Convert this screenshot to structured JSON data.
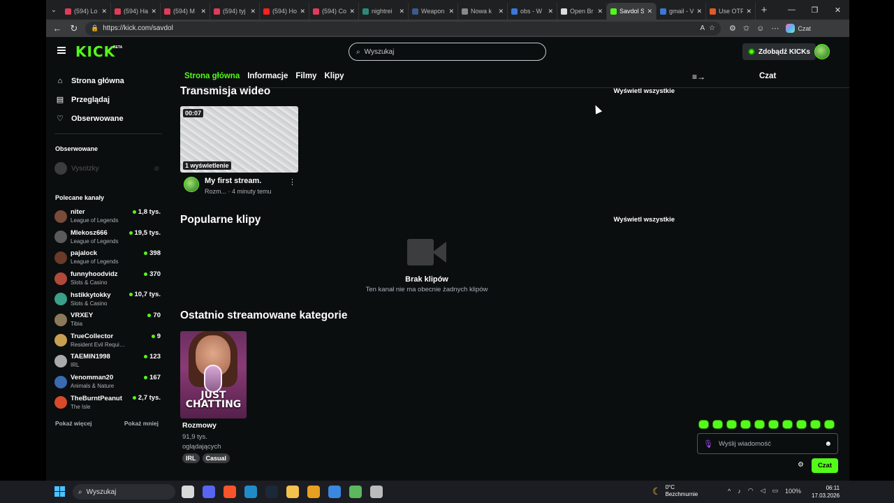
{
  "browser": {
    "tabs": [
      {
        "title": "(594) Lo",
        "color": "#e03c5a"
      },
      {
        "title": "(594) Ha",
        "color": "#e03c5a"
      },
      {
        "title": "(594) M",
        "color": "#e03c5a"
      },
      {
        "title": "(594) tyj",
        "color": "#e03c5a"
      },
      {
        "title": "(594) Ho",
        "color": "#ff2020"
      },
      {
        "title": "(594) Co",
        "color": "#e03c5a"
      },
      {
        "title": "nightrei",
        "color": "#2a8a7a"
      },
      {
        "title": "Weapon",
        "color": "#3a5a8a"
      },
      {
        "title": "Nowa k",
        "color": "#888888"
      },
      {
        "title": "obs - W",
        "color": "#3a78d8"
      },
      {
        "title": "Open Br",
        "color": "#dddddd"
      },
      {
        "title": "Savdol S",
        "color": "#53fc18",
        "active": true
      },
      {
        "title": "gmail - V",
        "color": "#3a78d8"
      },
      {
        "title": "Use OTP",
        "color": "#e05a2a"
      }
    ],
    "new_tab": "+",
    "url": "https://kick.com/savdol",
    "copilot_label": "Czat"
  },
  "header": {
    "logo": "KICK",
    "beta": "BETA",
    "search_placeholder": "Wyszukaj",
    "kicks_button": "Zdobądź KICKs"
  },
  "sidebar": {
    "nav": [
      {
        "label": "Strona główna",
        "icon": "home-icon",
        "glyph": "⌂"
      },
      {
        "label": "Przeglądaj",
        "icon": "browse-icon",
        "glyph": "▤"
      },
      {
        "label": "Obserwowane",
        "icon": "heart-icon",
        "glyph": "♡"
      }
    ],
    "followed_title": "Obserwowane",
    "followed": [
      {
        "name": "Vysotzky"
      }
    ],
    "recommended_title": "Polecane kanały",
    "recommended": [
      {
        "name": "niter",
        "category": "League of Legends",
        "viewers": "1,8 tys.",
        "color": "#7a4a3a"
      },
      {
        "name": "Mlekosz666",
        "category": "League of Legends",
        "viewers": "19,5 tys.",
        "color": "#5a5a5a"
      },
      {
        "name": "pajalock",
        "category": "League of Legends",
        "viewers": "398",
        "color": "#6a3a2a"
      },
      {
        "name": "funnyhoodvidz",
        "category": "Slots & Casino",
        "viewers": "370",
        "color": "#b04a3a"
      },
      {
        "name": "hstikkytokky",
        "category": "Slots & Casino",
        "viewers": "10,7 tys.",
        "color": "#3aa08a"
      },
      {
        "name": "VRXEY",
        "category": "Tibia",
        "viewers": "70",
        "color": "#8a7a5a"
      },
      {
        "name": "TrueCollector",
        "category": "Resident Evil Requiem",
        "viewers": "9",
        "color": "#c8a050"
      },
      {
        "name": "TAEMIN1998",
        "category": "IRL",
        "viewers": "123",
        "color": "#aaaaaa"
      },
      {
        "name": "Venomman20",
        "category": "Animals & Nature",
        "viewers": "167",
        "color": "#3a6ab0"
      },
      {
        "name": "TheBurntPeanut",
        "category": "The Isle",
        "viewers": "2,7 tys.",
        "color": "#d84a2a"
      }
    ],
    "show_more": "Pokaż więcej",
    "show_less": "Pokaż mniej"
  },
  "main": {
    "tabs": [
      {
        "label": "Strona główna",
        "active": true
      },
      {
        "label": "Informacje"
      },
      {
        "label": "Filmy"
      },
      {
        "label": "Klipy"
      }
    ],
    "videos": {
      "title": "Transmisja wideo",
      "see_all": "Wyświetl wszystkie",
      "item": {
        "duration": "00:07",
        "views": "1 wyświetlenie",
        "title": "My first stream.",
        "channel": "Rozm...",
        "ago": "· 4 minuty temu"
      }
    },
    "clips": {
      "title": "Popularne klipy",
      "see_all": "Wyświetl wszystkie",
      "empty_title": "Brak klipów",
      "empty_text": "Ten kanał nie ma obecnie żadnych klipów"
    },
    "categories": {
      "title": "Ostatnio streamowane kategorie",
      "item": {
        "art_text": "JUST CHATTING",
        "name": "Rozmowy",
        "viewers": "91,9 tys. oglądających",
        "tags": [
          "IRL",
          "Casual"
        ]
      }
    }
  },
  "chat": {
    "title": "Czat",
    "input_placeholder": "Wyślij wiadomość",
    "send_label": "Czat",
    "emote_count": 10
  },
  "taskbar": {
    "search_placeholder": "Wyszukaj",
    "apps": [
      "#d8d8d8",
      "#5865f2",
      "#fb542b",
      "#1f8cc9",
      "#1b2838",
      "#f2c14e",
      "#e8a020",
      "#3a88e0",
      "#5cb85c",
      "#bbbbbb"
    ],
    "weather_temp": "0°C",
    "weather_desc": "Bezchmurnie",
    "battery": "100%",
    "time": "06:11",
    "date": "17.03.2026"
  }
}
